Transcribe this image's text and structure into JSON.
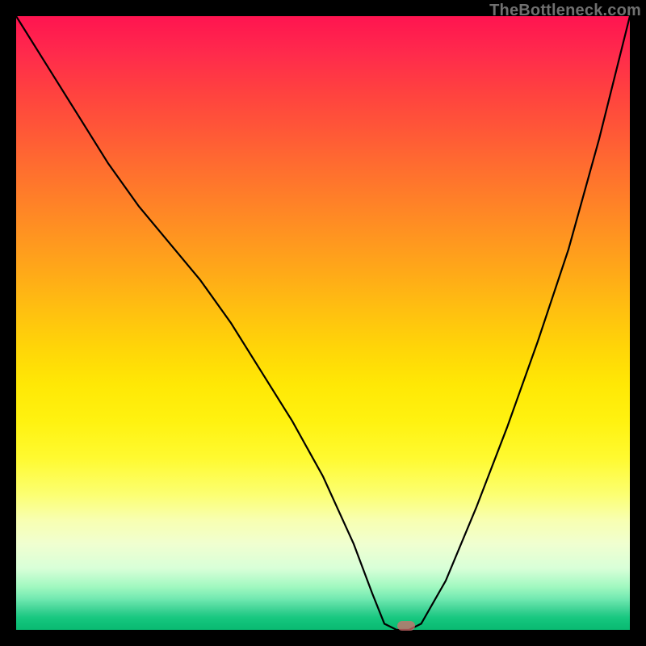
{
  "watermark": "TheBottleneck.com",
  "marker": {
    "x_pct": 63.5,
    "y_pct": 99.3
  },
  "chart_data": {
    "type": "line",
    "title": "",
    "xlabel": "",
    "ylabel": "",
    "xlim": [
      0,
      100
    ],
    "ylim": [
      0,
      100
    ],
    "series": [
      {
        "name": "bottleneck-curve",
        "x": [
          0,
          5,
          10,
          15,
          20,
          25,
          30,
          35,
          40,
          45,
          50,
          55,
          58,
          60,
          62,
          64,
          66,
          70,
          75,
          80,
          85,
          90,
          95,
          100
        ],
        "y": [
          100,
          92,
          84,
          76,
          69,
          63,
          57,
          50,
          42,
          34,
          25,
          14,
          6,
          1,
          0,
          0,
          1,
          8,
          20,
          33,
          47,
          62,
          80,
          100
        ]
      }
    ],
    "annotations": [
      {
        "type": "marker",
        "x": 63.5,
        "y": 0.7,
        "label": "optimal-point"
      }
    ],
    "background_gradient": {
      "direction": "vertical",
      "stops": [
        {
          "pos": 0.0,
          "color": "#ff1450"
        },
        {
          "pos": 0.5,
          "color": "#ffd508"
        },
        {
          "pos": 0.8,
          "color": "#fcff72"
        },
        {
          "pos": 1.0,
          "color": "#0aba72"
        }
      ]
    }
  }
}
